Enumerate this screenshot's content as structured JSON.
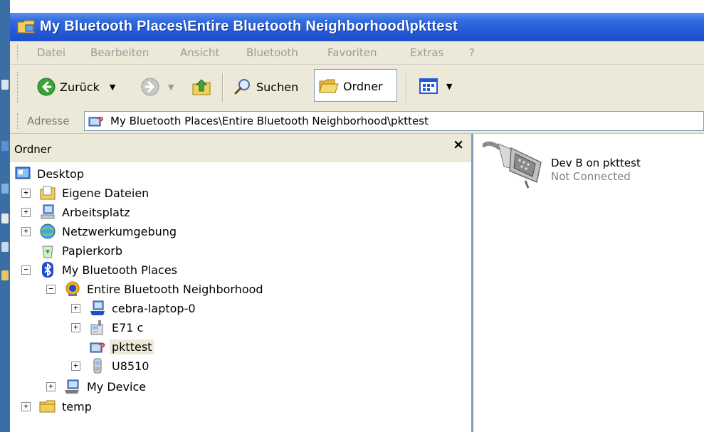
{
  "window": {
    "title": "My Bluetooth Places\\Entire Bluetooth Neighborhood\\pkttest",
    "accent_color": "#2457d6"
  },
  "menu": [
    "Datei",
    "Bearbeiten",
    "Ansicht",
    "Bluetooth",
    "Favoriten",
    "Extras",
    "?"
  ],
  "toolbar": {
    "back_label": "Zurück",
    "search_label": "Suchen",
    "folders_label": "Ordner"
  },
  "address": {
    "label": "Adresse",
    "value": "My Bluetooth Places\\Entire Bluetooth Neighborhood\\pkttest"
  },
  "folder_pane": {
    "title": "Ordner",
    "close": "×",
    "tree": [
      {
        "label": "Desktop",
        "icon": "desktop-icon",
        "expander": ""
      },
      {
        "label": "Eigene Dateien",
        "icon": "my-documents-icon",
        "expander": "+"
      },
      {
        "label": "Arbeitsplatz",
        "icon": "my-computer-icon",
        "expander": "+"
      },
      {
        "label": "Netzwerkumgebung",
        "icon": "network-icon",
        "expander": "+"
      },
      {
        "label": "Papierkorb",
        "icon": "recycle-bin-icon",
        "expander": ""
      },
      {
        "label": "My Bluetooth Places",
        "icon": "bluetooth-icon",
        "expander": "−"
      },
      {
        "label": "Entire Bluetooth Neighborhood",
        "icon": "bluetooth-neighborhood-icon",
        "expander": "−"
      },
      {
        "label": "cebra-laptop-0",
        "icon": "laptop-icon",
        "expander": "+"
      },
      {
        "label": "E71 c",
        "icon": "phone-icon",
        "expander": "+"
      },
      {
        "label": "pkttest",
        "icon": "unknown-device-icon",
        "expander": "",
        "selected": true
      },
      {
        "label": "U8510",
        "icon": "mobile-phone-icon",
        "expander": "+"
      },
      {
        "label": "My Device",
        "icon": "my-device-icon",
        "expander": "+"
      },
      {
        "label": "temp",
        "icon": "folder-icon",
        "expander": "+"
      }
    ]
  },
  "content": {
    "items": [
      {
        "name": "Dev B on pkttest",
        "status": "Not Connected",
        "icon": "serial-port-icon"
      }
    ]
  }
}
